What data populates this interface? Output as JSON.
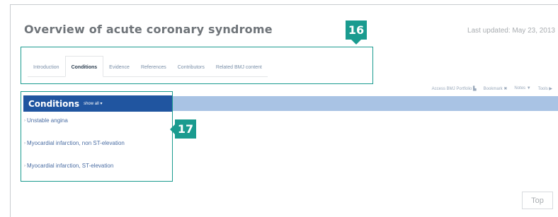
{
  "page": {
    "title": "Overview of acute coronary syndrome",
    "last_updated": "Last updated: May 23, 2013"
  },
  "tabs": [
    {
      "label": "Introduction",
      "active": false
    },
    {
      "label": "Conditions",
      "active": true
    },
    {
      "label": "Evidence",
      "active": false
    },
    {
      "label": "References",
      "active": false
    },
    {
      "label": "Contributors",
      "active": false
    },
    {
      "label": "Related BMJ content",
      "active": false
    }
  ],
  "tools": {
    "pdf": "Access BMJ Portfolio",
    "summary": "Bookmark",
    "notes": "Notes",
    "print": "Tools"
  },
  "conditions": {
    "title": "Conditions",
    "show_all": "show all",
    "items": [
      "Unstable angina",
      "Myocardial infarction, non ST-elevation",
      "Myocardial infarction, ST-elevation"
    ]
  },
  "callouts": {
    "tabs": "16",
    "conditions": "17"
  },
  "top_button": "Top",
  "colors": {
    "accent": "#1a9b8f",
    "header_blue": "#2055a0",
    "bar_blue": "#a9c3e4",
    "link_blue": "#4a6da3"
  }
}
